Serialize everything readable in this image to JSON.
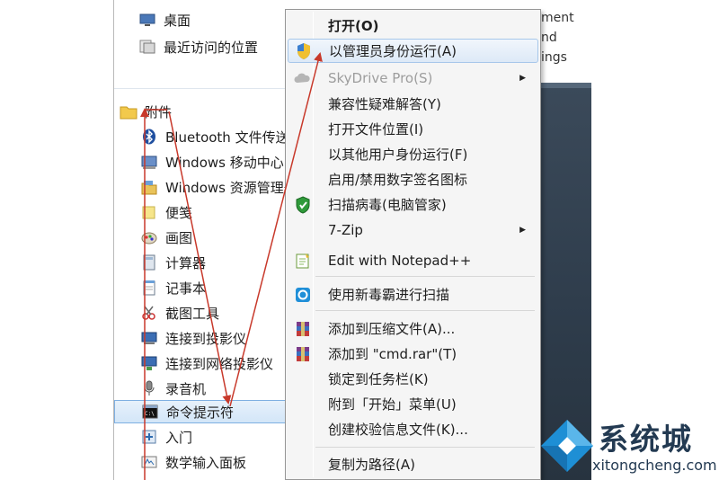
{
  "explorer": {
    "top_items": [
      {
        "label": "桌面",
        "icon": "desktop-icon"
      },
      {
        "label": "最近访问的位置",
        "icon": "recent-places-icon"
      }
    ],
    "folder": {
      "label": "附件",
      "icon": "folder-icon"
    },
    "items": [
      {
        "label": "Bluetooth 文件传送",
        "icon": "bluetooth-icon"
      },
      {
        "label": "Windows 移动中心",
        "icon": "mobility-center-icon"
      },
      {
        "label": "Windows 资源管理器",
        "icon": "explorer-icon"
      },
      {
        "label": "便笺",
        "icon": "sticky-notes-icon"
      },
      {
        "label": "画图",
        "icon": "paint-icon"
      },
      {
        "label": "计算器",
        "icon": "calculator-icon"
      },
      {
        "label": "记事本",
        "icon": "notepad-icon"
      },
      {
        "label": "截图工具",
        "icon": "snipping-tool-icon"
      },
      {
        "label": "连接到投影仪",
        "icon": "projector-icon"
      },
      {
        "label": "连接到网络投影仪",
        "icon": "network-projector-icon"
      },
      {
        "label": "录音机",
        "icon": "sound-recorder-icon"
      },
      {
        "label": "命令提示符",
        "icon": "cmd-icon",
        "selected": true
      },
      {
        "label": "入门",
        "icon": "getting-started-icon"
      },
      {
        "label": "数学输入面板",
        "icon": "math-input-icon"
      }
    ]
  },
  "right_fragment": [
    "ment",
    "nd",
    "ings"
  ],
  "context_menu": {
    "items": [
      {
        "label": "打开(O)",
        "bold": true
      },
      {
        "label": "以管理员身份运行(A)",
        "icon": "uac-shield-icon",
        "highlighted": true
      },
      {
        "label": "SkyDrive Pro(S)",
        "icon": "skydrive-icon",
        "disabled": true,
        "submenu": true
      },
      {
        "label": "兼容性疑难解答(Y)"
      },
      {
        "label": "打开文件位置(I)"
      },
      {
        "label": "以其他用户身份运行(F)"
      },
      {
        "label": "启用/禁用数字签名图标"
      },
      {
        "label": "扫描病毒(电脑管家)",
        "icon": "tencent-shield-icon"
      },
      {
        "label": "7-Zip",
        "submenu": true
      },
      {
        "label": "Edit with Notepad++",
        "icon": "notepadpp-icon"
      },
      {
        "label": "使用新毒霸进行扫描",
        "icon": "duba-icon",
        "separator_before": true
      },
      {
        "label": "添加到压缩文件(A)...",
        "icon": "winrar-icon",
        "separator_before": true
      },
      {
        "label": "添加到 \"cmd.rar\"(T)",
        "icon": "winrar-icon"
      },
      {
        "label": "锁定到任务栏(K)"
      },
      {
        "label": "附到「开始」菜单(U)"
      },
      {
        "label": "创建校验信息文件(K)..."
      },
      {
        "label": "复制为路径(A)",
        "separator_before": true
      }
    ],
    "submenu_arrow": "▶"
  },
  "watermark": {
    "brand": "系统城",
    "url": "xitongcheng.com"
  },
  "colors": {
    "arrow": "#c8392b",
    "selection": "#d3e6f8",
    "menu_bg": "#f5f5f5"
  }
}
